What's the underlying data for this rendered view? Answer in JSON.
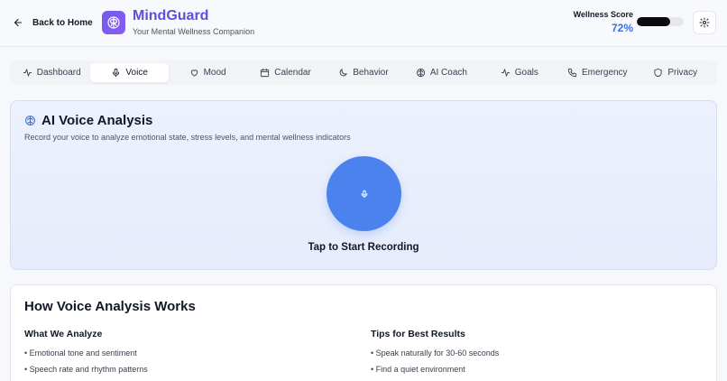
{
  "header": {
    "back_label": "Back to Home",
    "app_title": "MindGuard",
    "app_subtitle": "Your Mental Wellness Companion",
    "wellness_label": "Wellness Score",
    "wellness_value": "72%",
    "wellness_fraction": 0.72,
    "brand_color": "#5b4fdc",
    "accent_color": "#3b6fe0"
  },
  "tabs": [
    {
      "label": "Dashboard",
      "icon": "activity-icon"
    },
    {
      "label": "Voice",
      "icon": "mic-icon",
      "active": true
    },
    {
      "label": "Mood",
      "icon": "heart-icon"
    },
    {
      "label": "Calendar",
      "icon": "calendar-icon"
    },
    {
      "label": "Behavior",
      "icon": "moon-icon"
    },
    {
      "label": "AI Coach",
      "icon": "brain-icon"
    },
    {
      "label": "Goals",
      "icon": "activity-icon"
    },
    {
      "label": "Emergency",
      "icon": "phone-icon"
    },
    {
      "label": "Privacy",
      "icon": "shield-icon"
    }
  ],
  "voice": {
    "title": "AI Voice Analysis",
    "description": "Record your voice to analyze emotional state, stress levels, and mental wellness indicators",
    "record_label": "Tap to Start Recording",
    "button_color": "#4c82ee"
  },
  "how": {
    "title": "How Voice Analysis Works",
    "left_title": "What We Analyze",
    "left_items": [
      "• Emotional tone and sentiment",
      "• Speech rate and rhythm patterns"
    ],
    "right_title": "Tips for Best Results",
    "right_items": [
      "• Speak naturally for 30-60 seconds",
      "• Find a quiet environment"
    ]
  }
}
